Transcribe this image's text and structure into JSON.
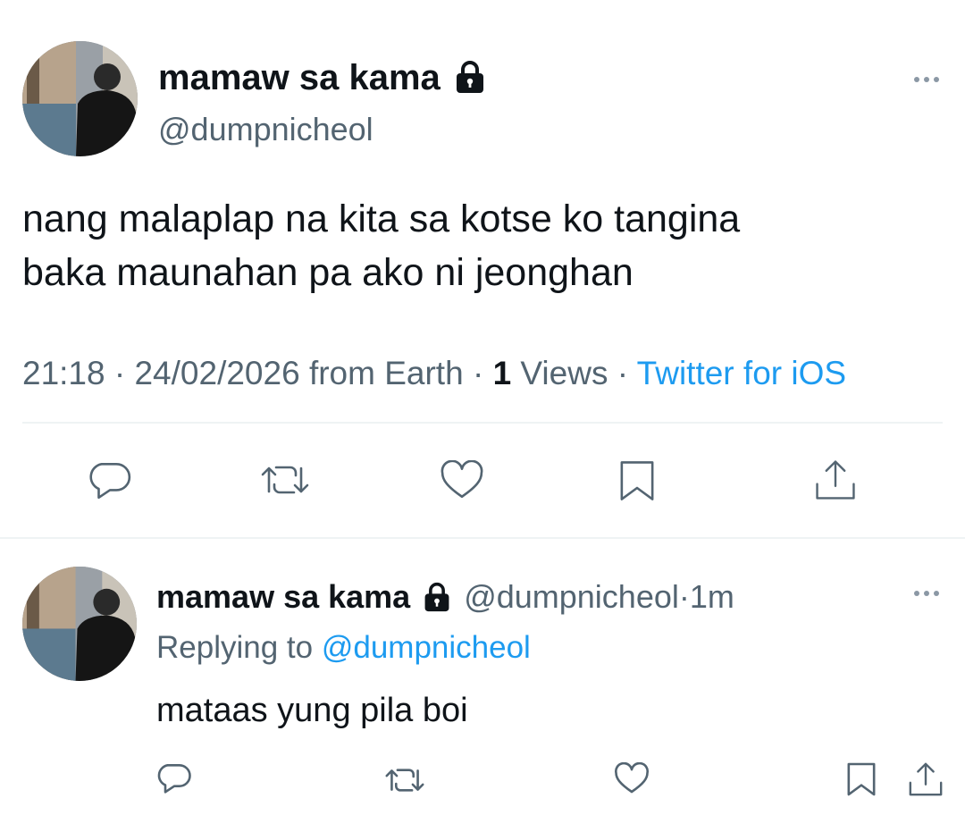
{
  "main_tweet": {
    "display_name": "mamaw sa kama",
    "handle": "@dumpnicheol",
    "lock_icon": "lock-icon",
    "more_icon": "more-dots-icon",
    "text_line1": "nang malaplap na kita sa kotse ko tangina",
    "text_line2": "baka maunahan pa ako ni jeonghan",
    "meta": {
      "time": "21:18",
      "sep1": " · ",
      "date_location": "24/02/2026 from Earth",
      "sep2": " · ",
      "views_count": "1",
      "views_label": " Views",
      "sep3": " · ",
      "source": "Twitter for iOS"
    },
    "actions": [
      "reply-icon",
      "retweet-icon",
      "like-icon",
      "bookmark-icon",
      "share-icon"
    ]
  },
  "reply": {
    "display_name": "mamaw sa kama",
    "handle": "@dumpnicheol",
    "time_sep": " · ",
    "time": "1m",
    "replying_prefix": "Replying to ",
    "replying_handle": "@dumpnicheol",
    "text": "mataas yung pila boi",
    "actions": [
      "reply-icon",
      "retweet-icon",
      "like-icon",
      "bookmark-icon",
      "share-icon"
    ]
  },
  "colors": {
    "text": "#0f1419",
    "secondary": "#536471",
    "accent_blue": "#1d9bf0",
    "divider": "#eff3f4"
  }
}
